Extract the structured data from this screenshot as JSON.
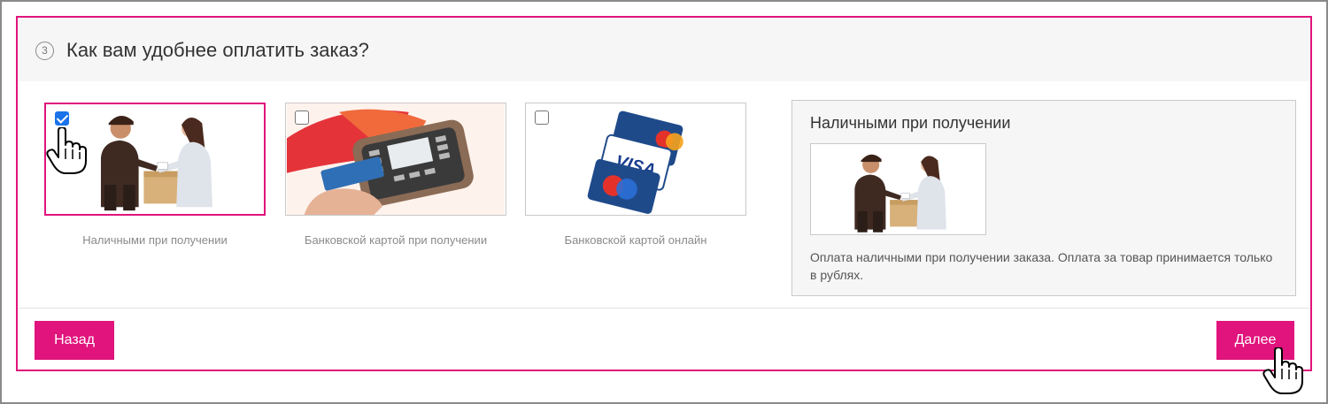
{
  "step": {
    "number": "3",
    "title": "Как вам удобнее оплатить заказ?"
  },
  "options": [
    {
      "label": "Наличными при получении",
      "checked": true,
      "icon": "courier-delivery-image"
    },
    {
      "label": "Банковской картой при получении",
      "checked": false,
      "icon": "card-terminal-image"
    },
    {
      "label": "Банковской картой онлайн",
      "checked": false,
      "icon": "credit-cards-image"
    }
  ],
  "description": {
    "title": "Наличными при получении",
    "text": "Оплата наличными при получении заказа. Оплата за товар принимается только в рублях.",
    "icon": "courier-delivery-image"
  },
  "buttons": {
    "back": "Назад",
    "next": "Далее"
  },
  "colors": {
    "accent": "#e0147c",
    "checkbox": "#1a73e8"
  }
}
